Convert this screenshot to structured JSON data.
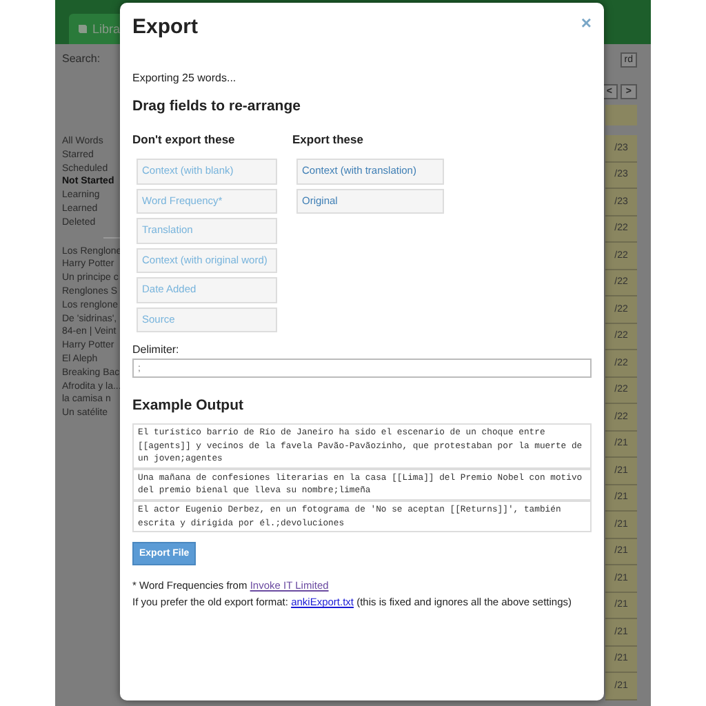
{
  "background": {
    "tab": "Libra",
    "search_label": "Search:",
    "word_button": "rd",
    "prev_button": "<",
    "next_button": ">",
    "filters": [
      {
        "label": "All Words",
        "selected": false
      },
      {
        "label": "Starred",
        "selected": false
      },
      {
        "label": "Scheduled",
        "selected": false
      },
      {
        "label": "Not Started",
        "selected": true
      },
      {
        "label": "Learning",
        "selected": false
      },
      {
        "label": "Learned",
        "selected": false
      },
      {
        "label": "Deleted",
        "selected": false
      }
    ],
    "sources": [
      "Los Renglone",
      "Harry Potter",
      "Un principe c",
      "Renglones S",
      "Los renglone",
      "De 'sidrinas',",
      "84-en | Veint",
      "Harry Potter",
      "El Aleph",
      "Breaking Bac",
      "Afrodita y la...",
      "la camisa n",
      "Un satélite"
    ],
    "dates": [
      "/23",
      "/23",
      "/23",
      "/22",
      "/22",
      "/22",
      "/22",
      "/22",
      "/22",
      "/22",
      "/22",
      "/21",
      "/21",
      "/21",
      "/21",
      "/21",
      "/21",
      "/21",
      "/21",
      "/21",
      "/21"
    ]
  },
  "dialog": {
    "title": "Export",
    "close": "×",
    "status": "Exporting 25 words...",
    "heading": "Drag fields to re-arrange",
    "columns": [
      {
        "heading": "Don't export these",
        "exported": false,
        "fields": [
          "Context (with blank)",
          "Word Frequency*",
          "Translation",
          "Context (with original word)",
          "Date Added",
          "Source"
        ]
      },
      {
        "heading": "Export these",
        "exported": true,
        "fields": [
          "Context (with translation)",
          "Original"
        ]
      }
    ],
    "delimiter": {
      "label": "Delimiter:",
      "value": ";"
    },
    "example_heading": "Example Output",
    "examples": [
      "El turístico barrio de Río de Janeiro ha sido el escenario de un choque entre [[agents]] y vecinos de la favela Pavão-Pavãozinho, que protestaban por la muerte de un joven;agentes",
      "Una mañana de confesiones literarias en la casa [[Lima]] del Premio Nobel con motivo del premio bienal que lleva su nombre;limeña",
      "El actor Eugenio Derbez, en un fotograma de 'No se aceptan [[Returns]]', también escrita y dirigida por él.;devoluciones"
    ],
    "export_button": "Export File",
    "footnote": {
      "text": "* Word Frequencies from ",
      "link": "Invoke IT Limited"
    },
    "old_format": {
      "text": "If you prefer the old export format: ",
      "link": "ankiExport.txt",
      "note": " (this is fixed and ignores all the above settings)"
    }
  }
}
